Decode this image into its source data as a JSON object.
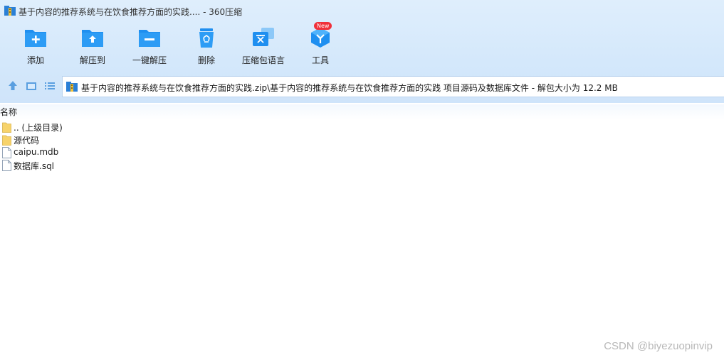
{
  "window": {
    "title": "基于内容的推荐系统与在饮食推荐方面的实践.... - 360压缩"
  },
  "toolbar": {
    "items": [
      {
        "label": "添加",
        "icon": "add-folder-icon"
      },
      {
        "label": "解压到",
        "icon": "extract-to-folder-icon"
      },
      {
        "label": "一键解压",
        "icon": "one-click-extract-icon"
      },
      {
        "label": "删除",
        "icon": "recycle-bin-icon"
      },
      {
        "label": "压缩包语言",
        "icon": "archive-language-icon"
      },
      {
        "label": "工具",
        "icon": "tools-icon",
        "badge": "New"
      }
    ]
  },
  "nav": {
    "path": "基于内容的推荐系统与在饮食推荐方面的实践.zip\\基于内容的推荐系统与在饮食推荐方面的实践 项目源码及数据库文件 - 解包大小为 12.2 MB"
  },
  "list": {
    "column_name": "名称",
    "items": [
      {
        "name": ".. (上级目录)",
        "type": "folder"
      },
      {
        "name": "源代码",
        "type": "folder"
      },
      {
        "name": "caipu.mdb",
        "type": "file"
      },
      {
        "name": "数据库.sql",
        "type": "file"
      }
    ]
  },
  "watermark": "CSDN @biyezuopinvip",
  "colors": {
    "accent": "#1f8ff0",
    "badge": "#f0303a",
    "folder": "#f7d36b"
  }
}
